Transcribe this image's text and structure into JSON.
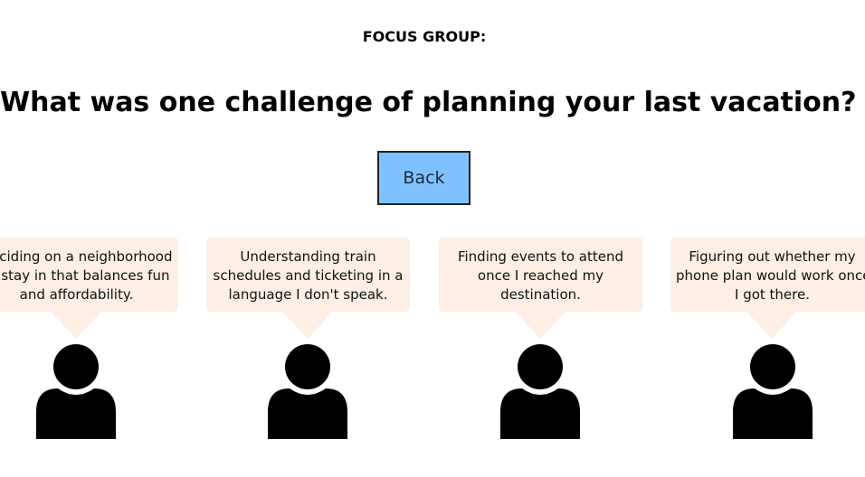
{
  "header": {
    "eyebrow": "FOCUS GROUP:",
    "question": "What was one challenge of planning your last vacation?"
  },
  "back_button": {
    "label": "Back"
  },
  "responses": [
    {
      "lines": [
        "Deciding on a neighborhood",
        "to stay in that balances fun",
        "and affordability."
      ]
    },
    {
      "lines": [
        "Understanding train",
        "schedules and ticketing in a",
        "language I don't speak."
      ]
    },
    {
      "lines": [
        "Finding events to attend",
        "once I reached my",
        "destination."
      ]
    },
    {
      "lines": [
        "Figuring out whether my",
        "phone plan would work once",
        "I got there."
      ]
    }
  ],
  "colors": {
    "bubble": "#fdefe5",
    "button": "#7fc1ff",
    "avatar": "#000000"
  },
  "icons": {
    "avatar": "person-icon"
  }
}
